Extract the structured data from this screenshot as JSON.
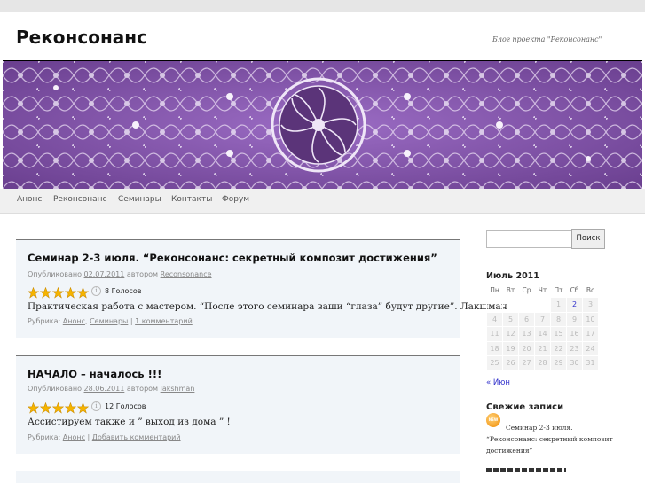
{
  "site": {
    "title": "Реконсонанс",
    "description": "Блог проекта \"Реконсонанс\""
  },
  "nav": {
    "items": [
      "Анонс",
      "Реконсонанс",
      "Семинары",
      "Контакты",
      "Форум"
    ]
  },
  "posts": [
    {
      "title": "Семинар 2-3 июля. “Реконсонанс: секретный композит достижения”",
      "meta_prefix": "Опубликовано",
      "date": "02.07.2011",
      "meta_author_prefix": "автором",
      "author": "Reconsonance",
      "votes": "8 Голосов",
      "rating": 5,
      "excerpt": "Практическая работа с мастером. “После этого семинара ваши “глаза” будут другие”. Лакшман",
      "rubric_prefix": "Рубрика:",
      "rubrics": [
        "Анонс",
        "Семинары"
      ],
      "comments": "1 комментарий"
    },
    {
      "title": "НАЧАЛО – началось !!!",
      "meta_prefix": "Опубликовано",
      "date": "28.06.2011",
      "meta_author_prefix": "автором",
      "author": "lakshman",
      "votes": "12 Голосов",
      "rating": 5,
      "excerpt": "Ассистируем также и ” выход из дома ” !",
      "rubric_prefix": "Рубрика:",
      "rubrics": [
        "Анонс"
      ],
      "comments": "Добавить комментарий"
    }
  ],
  "search": {
    "button": "Поиск",
    "value": ""
  },
  "calendar": {
    "caption": "Июль 2011",
    "weekdays": [
      "Пн",
      "Вт",
      "Ср",
      "Чт",
      "Пт",
      "Сб",
      "Вс"
    ],
    "weeks": [
      [
        "",
        "",
        "",
        "",
        "1",
        "2",
        "3"
      ],
      [
        "4",
        "5",
        "6",
        "7",
        "8",
        "9",
        "10"
      ],
      [
        "11",
        "12",
        "13",
        "14",
        "15",
        "16",
        "17"
      ],
      [
        "18",
        "19",
        "20",
        "21",
        "22",
        "23",
        "24"
      ],
      [
        "25",
        "26",
        "27",
        "28",
        "29",
        "30",
        "31"
      ]
    ],
    "linked_day": "2",
    "prev": "« Июн"
  },
  "recent": {
    "title": "Свежие записи",
    "badge": "NEW",
    "items": [
      "Семинар 2-3 июля. “Реконсонанс: секретный композит достижения”"
    ]
  },
  "colors": {
    "banner_purple": "#8a5fb0",
    "link_blue": "#3333cc",
    "post_bg": "#f1f5f9",
    "star_gold": "#f5b400"
  }
}
